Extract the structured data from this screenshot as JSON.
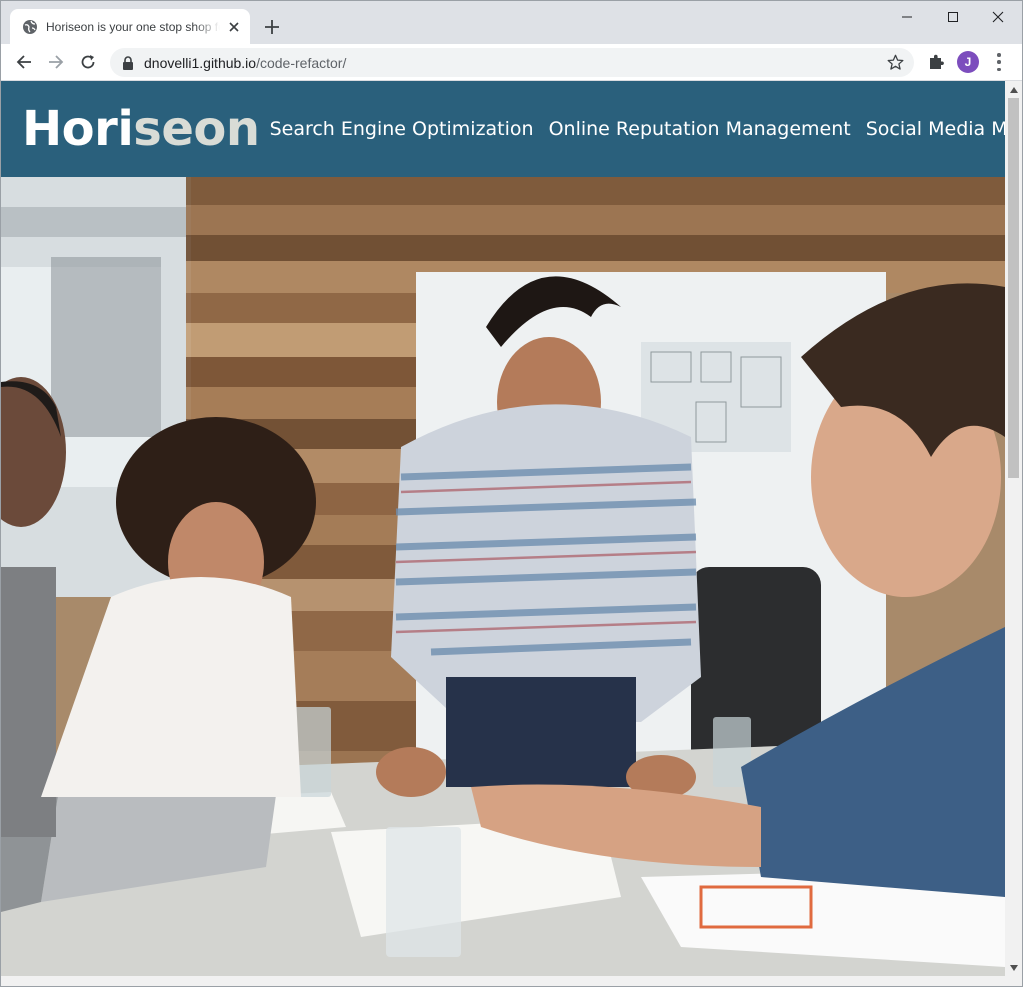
{
  "browser": {
    "tab": {
      "title": "Horiseon is your one stop shop for",
      "close_label": "×"
    },
    "new_tab_label": "+",
    "address": {
      "host": "dnovelli1.github.io",
      "path": "/code-refactor/"
    },
    "profile_initial": "J"
  },
  "site": {
    "logo": {
      "part1": "Hori",
      "part2": "seon"
    },
    "nav": [
      {
        "label": "Search Engine Optimization"
      },
      {
        "label": "Online Reputation Management"
      },
      {
        "label": "Social Media Marketing"
      }
    ]
  },
  "colors": {
    "header_bg": "#2a607c",
    "logo_accent": "#d9dcd6",
    "profile_avatar": "#7c4dbd"
  },
  "icons": {
    "favicon": "globe-icon",
    "hero_image": "office-meeting-photo"
  }
}
